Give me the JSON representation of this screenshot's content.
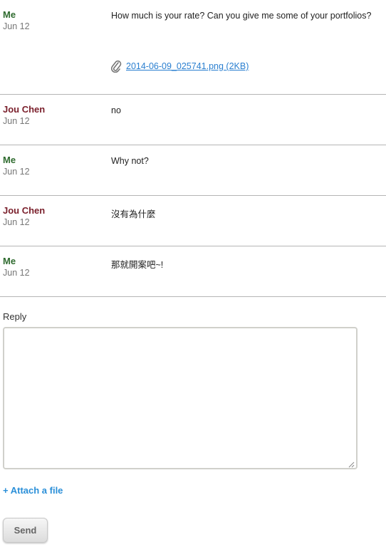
{
  "messages": [
    {
      "sender": "Me",
      "date": "Jun 12",
      "text": "How much is your rate? Can you give me some of your portfolios?",
      "attachment": "2014-06-09_025741.png (2KB)"
    },
    {
      "sender": "Jou Chen",
      "date": "Jun 12",
      "text": "no"
    },
    {
      "sender": "Me",
      "date": "Jun 12",
      "text": "Why not?"
    },
    {
      "sender": "Jou Chen",
      "date": "Jun 12",
      "text": "沒有為什麼"
    },
    {
      "sender": "Me",
      "date": "Jun 12",
      "text": "那就開案吧~!"
    }
  ],
  "reply": {
    "label": "Reply",
    "value": "",
    "attach_label": "+ Attach a file",
    "send_label": "Send"
  },
  "colors": {
    "me": "#2f6b2f",
    "other": "#7a1f2b",
    "link": "#2a8fd8",
    "divider": "#b5b5b5"
  },
  "icons": {
    "attachment": "paperclip-icon",
    "resize": "resize-grip-icon"
  }
}
